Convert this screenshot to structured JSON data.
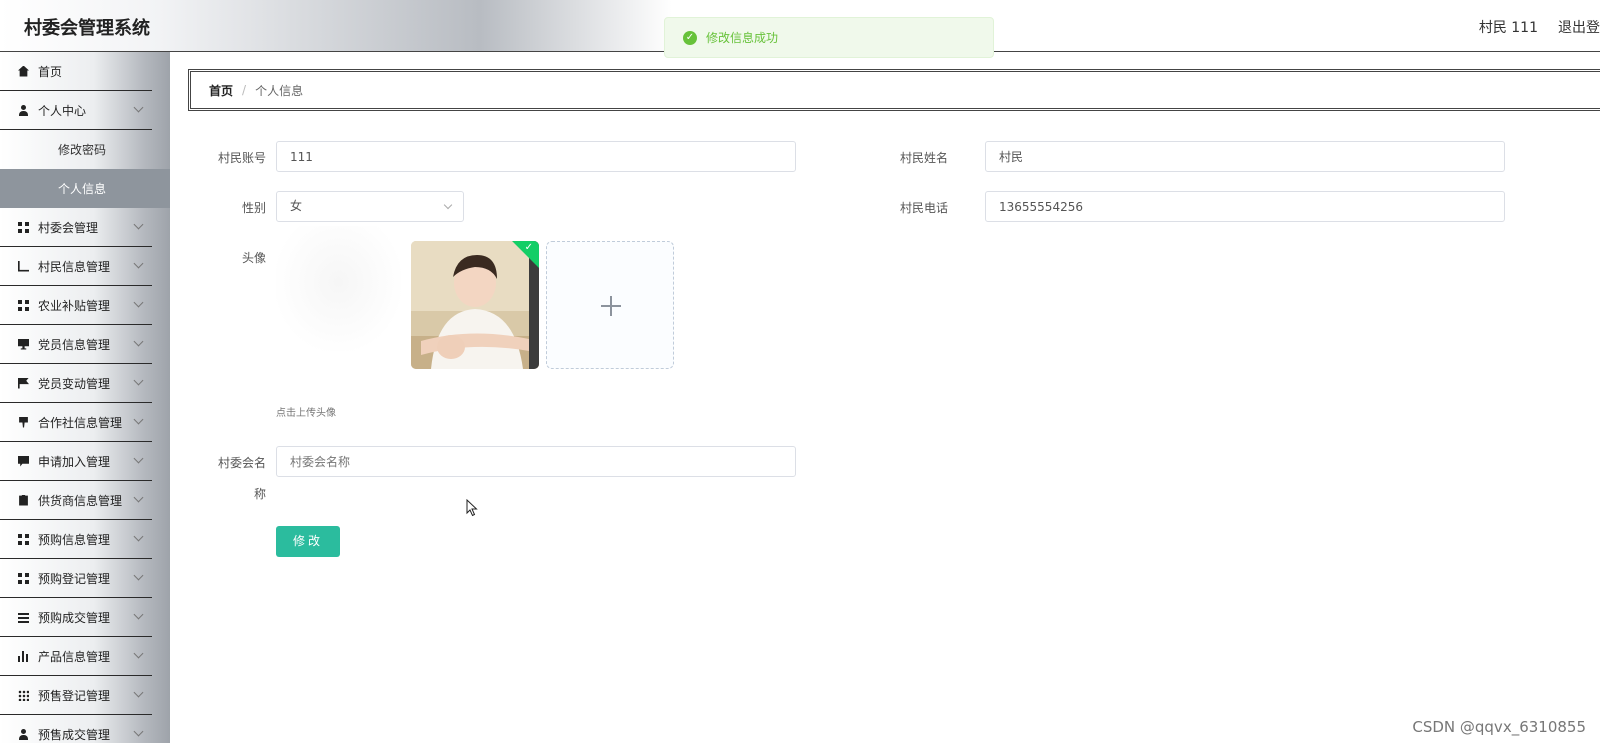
{
  "header": {
    "title": "村委会管理系统",
    "user_label": "村民 111",
    "logout_label": "退出登"
  },
  "toast": {
    "message": "修改信息成功",
    "color": "#67c23a"
  },
  "sidebar": {
    "items": [
      {
        "label": "首页",
        "icon": "home-icon"
      },
      {
        "label": "个人中心",
        "icon": "user-icon"
      },
      {
        "label": "村委会管理",
        "icon": "grid-icon"
      },
      {
        "label": "村民信息管理",
        "icon": "chart-icon"
      },
      {
        "label": "农业补贴管理",
        "icon": "grid-icon"
      },
      {
        "label": "党员信息管理",
        "icon": "monitor-icon"
      },
      {
        "label": "党员变动管理",
        "icon": "flag-icon"
      },
      {
        "label": "合作社信息管理",
        "icon": "pin-icon"
      },
      {
        "label": "申请加入管理",
        "icon": "chat-icon"
      },
      {
        "label": "供货商信息管理",
        "icon": "clipboard-icon"
      },
      {
        "label": "预购信息管理",
        "icon": "grid-icon"
      },
      {
        "label": "预购登记管理",
        "icon": "grid-icon"
      },
      {
        "label": "预购成交管理",
        "icon": "list-icon"
      },
      {
        "label": "产品信息管理",
        "icon": "bar-chart-icon"
      },
      {
        "label": "预售登记管理",
        "icon": "grid-dots-icon"
      },
      {
        "label": "预售成交管理",
        "icon": "user-icon"
      }
    ],
    "sub_items": [
      {
        "label": "修改密码"
      },
      {
        "label": "个人信息"
      }
    ],
    "active_color": "#8e959d"
  },
  "breadcrumb": {
    "home": "首页",
    "separator": "/",
    "current": "个人信息"
  },
  "form": {
    "account_label": "村民账号",
    "account_value": "111",
    "name_label": "村民姓名",
    "name_value": "村民",
    "gender_label": "性别",
    "gender_value": "女",
    "phone_label": "村民电话",
    "phone_value": "13655554256",
    "avatar_label": "头像",
    "upload_tip": "点击上传头像",
    "village_label_1": "村委会名",
    "village_label_2": "称",
    "village_placeholder": "村委会名称",
    "submit_label": "修改",
    "submit_color": "#2bbc9e"
  },
  "watermark": "CSDN @qqvx_6310855"
}
